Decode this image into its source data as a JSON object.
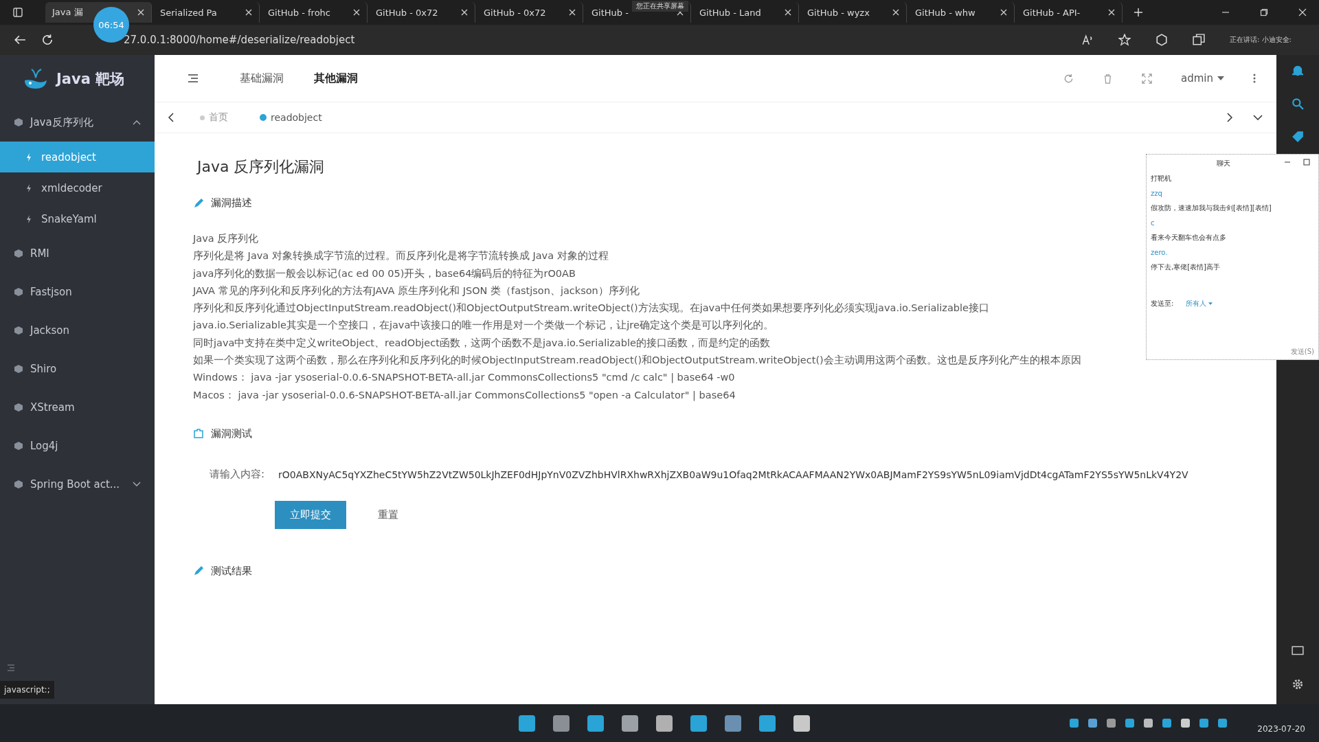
{
  "browser": {
    "tabs": [
      {
        "title": "Java 漏",
        "selected": true
      },
      {
        "title": "Serialized Pa",
        "selected": false
      },
      {
        "title": "GitHub - frohc",
        "selected": false
      },
      {
        "title": "GitHub - 0x72",
        "selected": false
      },
      {
        "title": "GitHub - 0x72",
        "selected": false
      },
      {
        "title": "GitHub -",
        "selected": false
      },
      {
        "title": "GitHub - Land",
        "selected": false
      },
      {
        "title": "GitHub - wyzx",
        "selected": false
      },
      {
        "title": "GitHub - whw",
        "selected": false
      },
      {
        "title": "GitHub - API-",
        "selected": false
      }
    ],
    "timer": "06:54",
    "banner": "您正在共享屏幕",
    "url": "27.0.0.1:8000/home#/deserialize/readobject",
    "speaking": "正在讲话: 小迪安全:"
  },
  "sidebar": {
    "logo": "Java 靶场",
    "items": [
      {
        "label": "Java反序列化",
        "expanded": true,
        "children": [
          {
            "label": "readobject",
            "selected": true
          },
          {
            "label": "xmldecoder",
            "selected": false
          },
          {
            "label": "SnakeYaml",
            "selected": false
          }
        ]
      },
      {
        "label": "RMI"
      },
      {
        "label": "Fastjson"
      },
      {
        "label": "Jackson"
      },
      {
        "label": "Shiro"
      },
      {
        "label": "XStream"
      },
      {
        "label": "Log4j"
      },
      {
        "label": "Spring Boot act...",
        "expanded": false
      }
    ],
    "status": "javascript:;"
  },
  "header": {
    "nav": [
      {
        "label": "基础漏洞",
        "selected": false
      },
      {
        "label": "其他漏洞",
        "selected": true
      }
    ],
    "user": "admin"
  },
  "tags": [
    {
      "label": "首页",
      "selected": false
    },
    {
      "label": "readobject",
      "selected": true
    }
  ],
  "page": {
    "title": "Java 反序列化漏洞",
    "description": {
      "title": "漏洞描述",
      "lines": [
        "Java 反序列化",
        "序列化是将 Java 对象转换成字节流的过程。而反序列化是将字节流转换成 Java 对象的过程",
        "java序列化的数据一般会以标记(ac ed 00 05)开头，base64编码后的特征为rO0AB",
        "JAVA 常见的序列化和反序列化的方法有JAVA 原生序列化和 JSON 类（fastjson、jackson）序列化",
        "序列化和反序列化通过ObjectInputStream.readObject()和ObjectOutputStream.writeObject()方法实现。在java中任何类如果想要序列化必须实现java.io.Serializable接口",
        "java.io.Serializable其实是一个空接口，在java中该接口的唯一作用是对一个类做一个标记，让jre确定这个类是可以序列化的。",
        "同时java中支持在类中定义writeObject、readObject函数，这两个函数不是java.io.Serializable的接口函数，而是约定的函数",
        "如果一个类实现了这两个函数，那么在序列化和反序列化的时候ObjectInputStream.readObject()和ObjectOutputStream.writeObject()会主动调用这两个函数。这也是反序列化产生的根本原因",
        "Windows： java -jar ysoserial-0.0.6-SNAPSHOT-BETA-all.jar CommonsCollections5 \"cmd /c calc\" | base64 -w0",
        "Macos： java -jar ysoserial-0.0.6-SNAPSHOT-BETA-all.jar CommonsCollections5 \"open -a Calculator\" | base64"
      ]
    },
    "test": {
      "title": "漏洞测试",
      "label": "请输入内容:",
      "value": "rO0ABXNyAC5qYXZheC5tYW5hZ2VtZW50LkJhZEF0dHJpYnV0ZVZhbHVlRXhwRXhjZXB0aW9u1Ofaq2MtRkACAAFMAAN2YWx0ABJMamF2YS9sYW5nL09iamVjdDt4cgATamF2YS5sYW5nLkV4Y2V",
      "submit": "立即提交",
      "reset": "重置"
    },
    "result": {
      "title": "测试结果"
    }
  },
  "chat": {
    "title": "聊天",
    "messages": [
      {
        "kind": "text",
        "text": "打靶机"
      },
      {
        "kind": "name",
        "text": "zzq"
      },
      {
        "kind": "text",
        "text": "假攻防，速速加我与我击剑[表情][表情]"
      },
      {
        "kind": "name",
        "text": "c"
      },
      {
        "kind": "text",
        "text": "看来今天翻车也会有点多"
      },
      {
        "kind": "name",
        "text": "zero."
      },
      {
        "kind": "text",
        "text": "停下去,寒佬[表情]高手"
      }
    ],
    "send_to": "发送至:",
    "recipient": "所有人",
    "send": "发送(S)"
  },
  "taskbar": {
    "date": "2023-07-20"
  }
}
